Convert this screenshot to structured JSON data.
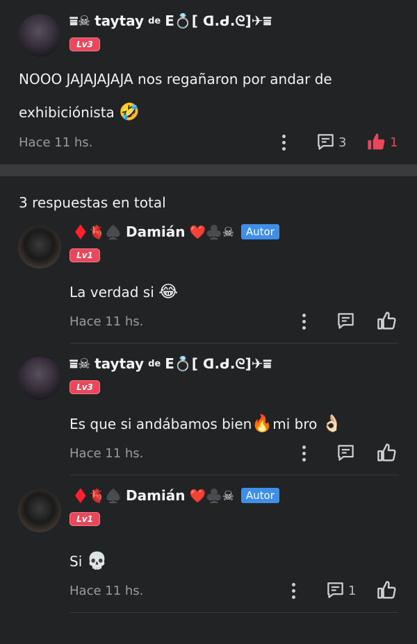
{
  "main_comment": {
    "user_name": "taytay",
    "name_prefix": "⩸☠︎",
    "name_de": "de",
    "name_suffix": "E💍[ ᗡ.ᑯ.ᘓ]✈︎⩸",
    "level": "Lv3",
    "text_line1": "NOOO JAJAJAJAJA nos regañaron por andar de",
    "text_line2": "exhibiciónista",
    "text_emoji": "🤣",
    "time": "Hace 11 hs.",
    "comments_count": "3",
    "likes_count": "1"
  },
  "replies_header": "3 respuestas en total",
  "replies": [
    {
      "name_prefix": "♦️🫀♠️",
      "user_name": "Damián",
      "name_suffix": "❤️♣️☠︎",
      "badge": "Autor",
      "level": "Lv1",
      "text": "La verdad si",
      "emoji": "😂",
      "time": "Hace 11 hs."
    },
    {
      "name_prefix": "⩸☠︎",
      "user_name": "taytay",
      "name_de": "de",
      "name_suffix": "E💍[ ᗡ.ᑯ.ᘓ]✈︎⩸",
      "level": "Lv3",
      "text": "Es que si andábamos bien",
      "emoji": "🔥",
      "text2": "mi bro",
      "emoji2": "👌🏻",
      "time": "Hace 11 hs."
    },
    {
      "name_prefix": "♦️🫀♠️",
      "user_name": "Damián",
      "name_suffix": "❤️♣️☠︎",
      "badge": "Autor",
      "level": "Lv1",
      "text": "Si",
      "emoji": "💀",
      "time": "Hace 11 hs.",
      "comments_count": "1"
    }
  ],
  "colors": {
    "background": "#222325",
    "level_badge": "#e9475c",
    "author_badge": "#3d8fe8",
    "like_active": "#e9475c"
  },
  "icons": [
    "more-vertical-icon",
    "comment-icon",
    "thumbs-up-icon"
  ]
}
